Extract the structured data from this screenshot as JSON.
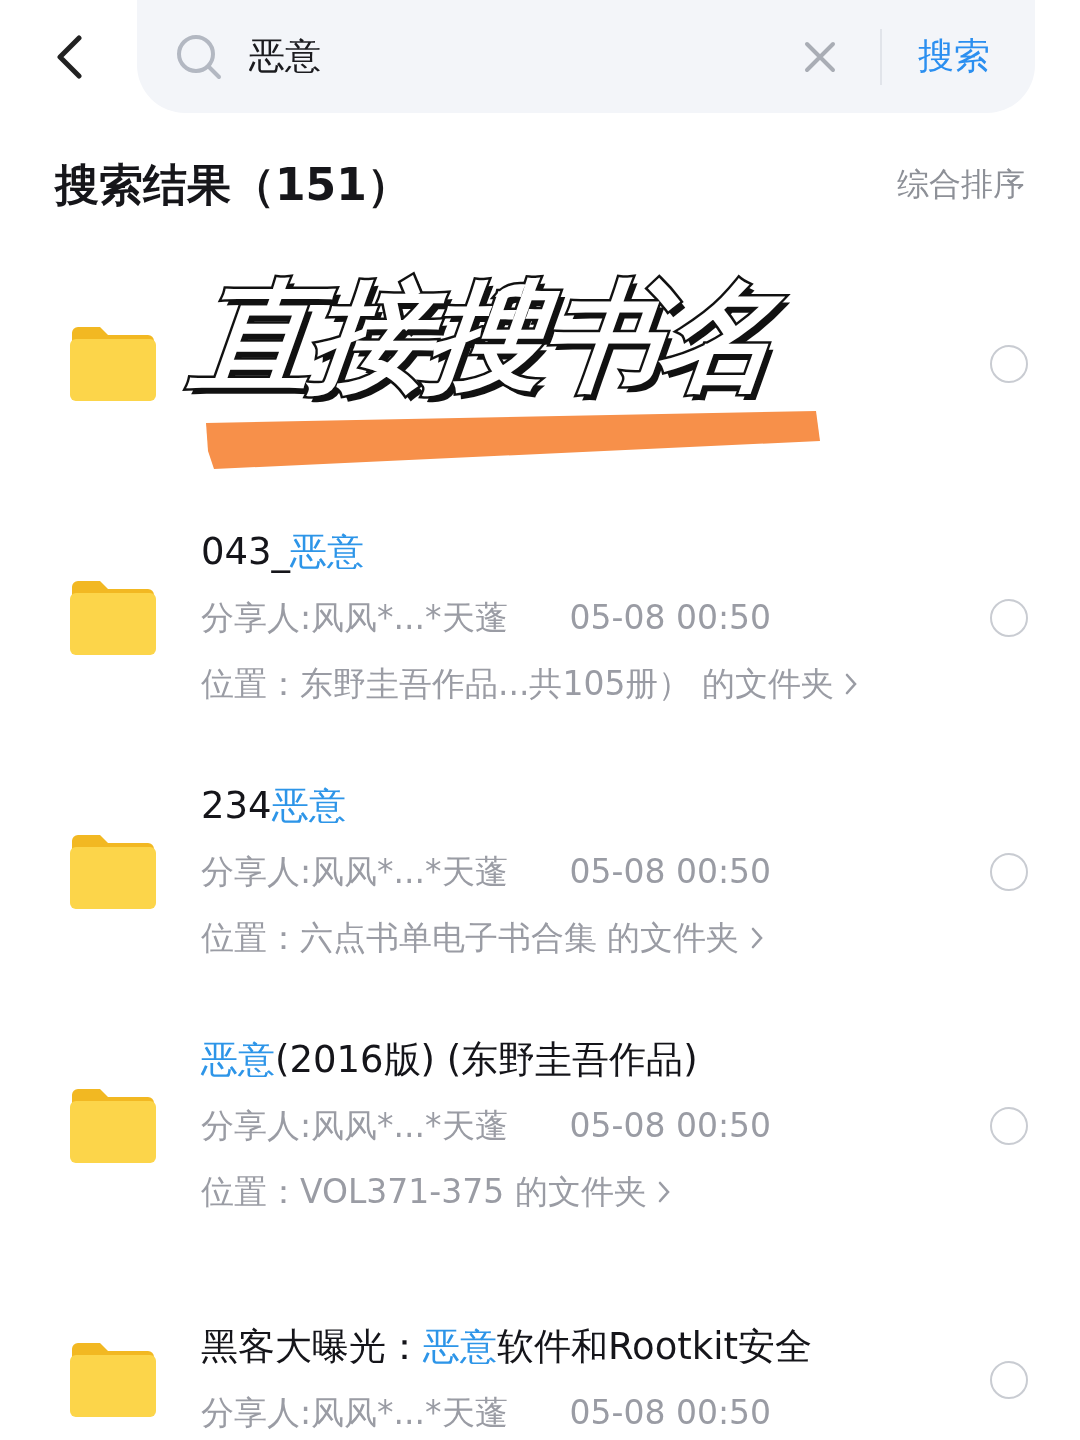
{
  "search": {
    "value": "恶意",
    "button": "搜索"
  },
  "results_header": {
    "title": "搜索结果（151）",
    "sort": "综合排序"
  },
  "banner": {
    "text": "直接搜书名"
  },
  "results": [
    {
      "covered": true,
      "selected": false
    },
    {
      "covered": false,
      "selected": false,
      "title": [
        {
          "text": "043_",
          "highlight": false
        },
        {
          "text": "恶意",
          "highlight": true
        }
      ],
      "sharer": "分享人:风风*...*天蓬",
      "time": "05-08 00:50",
      "location": "位置：东野圭吾作品...共105册） 的文件夹"
    },
    {
      "covered": false,
      "selected": false,
      "title": [
        {
          "text": "234",
          "highlight": false
        },
        {
          "text": "恶意",
          "highlight": true
        }
      ],
      "sharer": "分享人:风风*...*天蓬",
      "time": "05-08 00:50",
      "location": "位置：六点书单电子书合集 的文件夹"
    },
    {
      "covered": false,
      "selected": false,
      "title": [
        {
          "text": "恶意",
          "highlight": true
        },
        {
          "text": "(2016版) (东野圭吾作品)",
          "highlight": false
        }
      ],
      "sharer": "分享人:风风*...*天蓬",
      "time": "05-08 00:50",
      "location": "位置：VOL371-375 的文件夹"
    },
    {
      "covered": false,
      "selected": false,
      "title": [
        {
          "text": "黑客大曝光：",
          "highlight": false
        },
        {
          "text": "恶意",
          "highlight": true
        },
        {
          "text": "软件和Rootkit安全",
          "highlight": false
        }
      ],
      "sharer": "分享人:风风*...*天蓬",
      "time": "05-08 00:50"
    }
  ]
}
